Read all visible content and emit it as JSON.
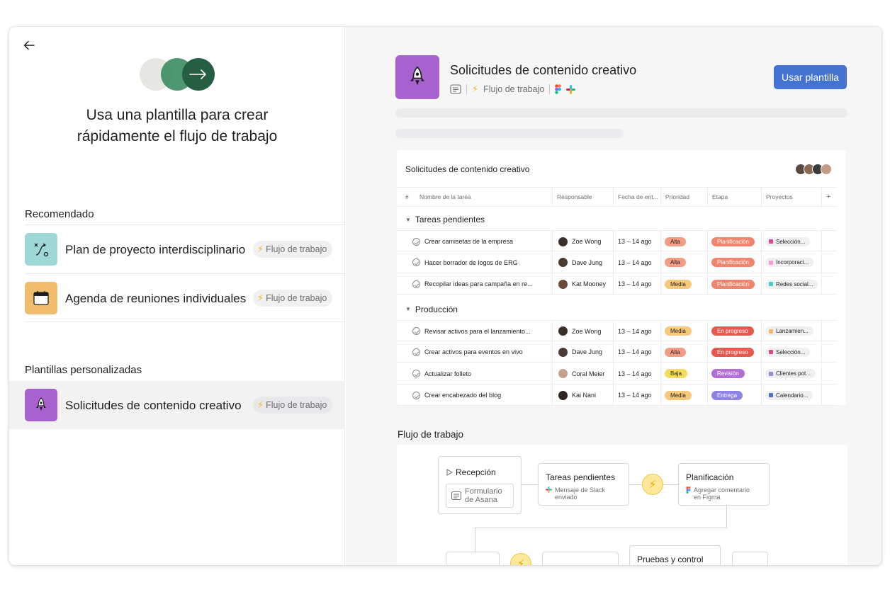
{
  "left": {
    "hero_title_line1": "Usa una plantilla para crear",
    "hero_title_line2": "rápidamente el flujo de trabajo",
    "recommended_label": "Recomendado",
    "custom_label": "Plantillas personalizadas",
    "recommended": [
      {
        "name": "Plan de proyecto interdisciplinario",
        "chip": "Flujo de trabajo",
        "color": "#9ed8d6"
      },
      {
        "name": "Agenda de reuniones individuales",
        "chip": "Flujo de trabajo",
        "color": "#f1bd6c"
      }
    ],
    "custom": [
      {
        "name": "Solicitudes de contenido creativo",
        "chip": "Flujo de trabajo",
        "color": "#a862cf"
      }
    ]
  },
  "right": {
    "title": "Solicitudes de contenido creativo",
    "meta_workflow": "Flujo de trabajo",
    "use_button": "Usar plantilla",
    "table": {
      "title": "Solicitudes de contenido creativo",
      "columns": [
        "#",
        "Nombre de la tarea",
        "Responsable",
        "Fecha de ent...",
        "Prioridad",
        "Etapa",
        "Proyectos",
        "+"
      ],
      "groups": [
        {
          "name": "Tareas pendientes",
          "rows": [
            {
              "task": "Crear camisetas de la empresa",
              "owner": "Zoe Wong",
              "date": "13 – 14 ago",
              "priority": "Alta",
              "stage": "Planificación",
              "project": "Selección..."
            },
            {
              "task": "Hacer borrador de logos de ERG",
              "owner": "Dave Jung",
              "date": "13 – 14 ago",
              "priority": "Alta",
              "stage": "Planificación",
              "project": "Incorporaci..."
            },
            {
              "task": "Recopilar ideas para campaña en re...",
              "owner": "Kat Mooney",
              "date": "13 – 14 ago",
              "priority": "Media",
              "stage": "Planificación",
              "project": "Redes social..."
            }
          ]
        },
        {
          "name": "Producción",
          "rows": [
            {
              "task": "Revisar activos para el lanzamiento...",
              "owner": "Zoe Wong",
              "date": "13 – 14 ago",
              "priority": "Media",
              "stage": "En progreso",
              "project": "Lanzamien..."
            },
            {
              "task": "Crear activos para eventos en vivo",
              "owner": "Dave Jung",
              "date": "13 – 14 ago",
              "priority": "Alta",
              "stage": "En progreso",
              "project": "Selección..."
            },
            {
              "task": "Actualizar folleto",
              "owner": "Coral Meier",
              "date": "13 – 14 ago",
              "priority": "Baja",
              "stage": "Revisión",
              "project": "Clientes pot..."
            },
            {
              "task": "Crear encabezado del blog",
              "owner": "Kai Nani",
              "date": "13 – 14 ago",
              "priority": "Media",
              "stage": "Entrega",
              "project": "Calendario..."
            }
          ]
        }
      ]
    },
    "workflow": {
      "label": "Flujo de trabajo",
      "intake": "Recepción",
      "intake_form_line1": "Formulario",
      "intake_form_line2": "de Asana",
      "todo": "Tareas pendientes",
      "todo_sub_line1": "Mensaje de Slack",
      "todo_sub_line2": "enviado",
      "planning": "Planificación",
      "planning_sub_line1": "Agregar comentario",
      "planning_sub_line2": "en Figma",
      "testing": "Pruebas y control"
    }
  }
}
